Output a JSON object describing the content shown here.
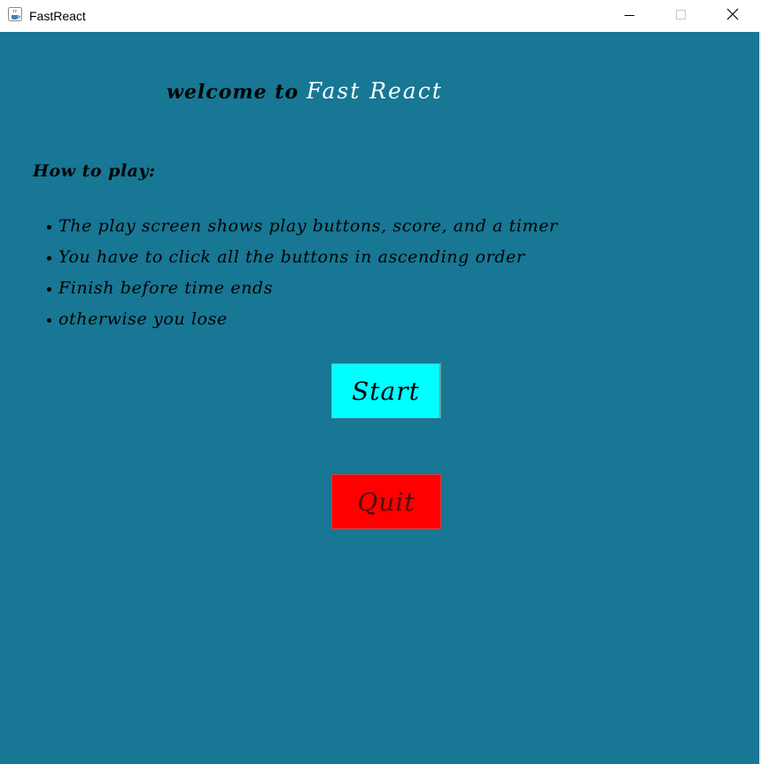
{
  "window": {
    "title": "FastReact",
    "icon": "java-cup-icon",
    "controls": [
      "minimize-icon",
      "maximize-icon",
      "close-icon"
    ]
  },
  "colors": {
    "background": "#177794",
    "start_button": "#00ffff",
    "quit_button": "#ff0000",
    "brand_text": "#ffffff"
  },
  "header": {
    "welcome_prefix": "welcome to",
    "brand": "Fast React"
  },
  "instructions": {
    "heading": "How to play:",
    "items": [
      "The play screen shows play buttons, score, and a timer",
      "You have to click all the buttons in ascending order",
      "Finish before time ends",
      "otherwise you lose"
    ]
  },
  "buttons": {
    "start_label": "Start",
    "quit_label": "Quit"
  }
}
